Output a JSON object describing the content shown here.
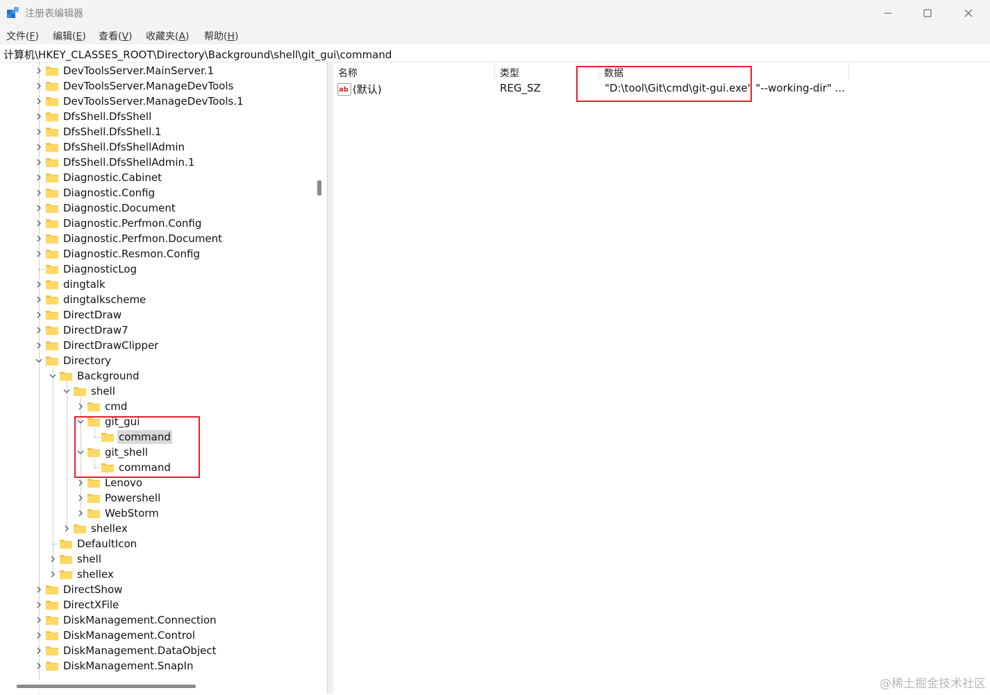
{
  "window": {
    "title": "注册表编辑器",
    "icons": [
      "registry-editor-icon",
      "minimize-icon",
      "maximize-icon",
      "close-icon"
    ]
  },
  "menu": [
    {
      "label": "文件(",
      "key": "F",
      "end": ")"
    },
    {
      "label": "编辑(",
      "key": "E",
      "end": ")"
    },
    {
      "label": "查看(",
      "key": "V",
      "end": ")"
    },
    {
      "label": "收藏夹(",
      "key": "A",
      "end": ")"
    },
    {
      "label": "帮助(",
      "key": "H",
      "end": ")"
    }
  ],
  "address": "计算机\\HKEY_CLASSES_ROOT\\Directory\\Background\\shell\\git_gui\\command",
  "tree": [
    {
      "label": "DevToolsServer.MainServer.1",
      "level": 0,
      "expander": ">"
    },
    {
      "label": "DevToolsServer.ManageDevTools",
      "level": 0,
      "expander": ">"
    },
    {
      "label": "DevToolsServer.ManageDevTools.1",
      "level": 0,
      "expander": ">"
    },
    {
      "label": "DfsShell.DfsShell",
      "level": 0,
      "expander": ">"
    },
    {
      "label": "DfsShell.DfsShell.1",
      "level": 0,
      "expander": ">"
    },
    {
      "label": "DfsShell.DfsShellAdmin",
      "level": 0,
      "expander": ">"
    },
    {
      "label": "DfsShell.DfsShellAdmin.1",
      "level": 0,
      "expander": ">"
    },
    {
      "label": "Diagnostic.Cabinet",
      "level": 0,
      "expander": ">"
    },
    {
      "label": "Diagnostic.Config",
      "level": 0,
      "expander": ">"
    },
    {
      "label": "Diagnostic.Document",
      "level": 0,
      "expander": ">"
    },
    {
      "label": "Diagnostic.Perfmon.Config",
      "level": 0,
      "expander": ">"
    },
    {
      "label": "Diagnostic.Perfmon.Document",
      "level": 0,
      "expander": ">"
    },
    {
      "label": "Diagnostic.Resmon.Config",
      "level": 0,
      "expander": ">"
    },
    {
      "label": "DiagnosticLog",
      "level": 0,
      "expander": ""
    },
    {
      "label": "dingtalk",
      "level": 0,
      "expander": ">"
    },
    {
      "label": "dingtalkscheme",
      "level": 0,
      "expander": ">"
    },
    {
      "label": "DirectDraw",
      "level": 0,
      "expander": ">"
    },
    {
      "label": "DirectDraw7",
      "level": 0,
      "expander": ">"
    },
    {
      "label": "DirectDrawClipper",
      "level": 0,
      "expander": ">"
    },
    {
      "label": "Directory",
      "level": 0,
      "expander": "v"
    },
    {
      "label": "Background",
      "level": 1,
      "expander": "v"
    },
    {
      "label": "shell",
      "level": 2,
      "expander": "v"
    },
    {
      "label": "cmd",
      "level": 3,
      "expander": ">"
    },
    {
      "label": "git_gui",
      "level": 3,
      "expander": "v"
    },
    {
      "label": "command",
      "level": 4,
      "expander": "",
      "selected": true
    },
    {
      "label": "git_shell",
      "level": 3,
      "expander": "v"
    },
    {
      "label": "command",
      "level": 4,
      "expander": ""
    },
    {
      "label": "Lenovo",
      "level": 3,
      "expander": ">"
    },
    {
      "label": "Powershell",
      "level": 3,
      "expander": ">"
    },
    {
      "label": "WebStorm",
      "level": 3,
      "expander": ">"
    },
    {
      "label": "shellex",
      "level": 2,
      "expander": ">"
    },
    {
      "label": "DefaultIcon",
      "level": 1,
      "expander": ""
    },
    {
      "label": "shell",
      "level": 1,
      "expander": ">"
    },
    {
      "label": "shellex",
      "level": 1,
      "expander": ">"
    },
    {
      "label": "DirectShow",
      "level": 0,
      "expander": ">"
    },
    {
      "label": "DirectXFile",
      "level": 0,
      "expander": ">"
    },
    {
      "label": "DiskManagement.Connection",
      "level": 0,
      "expander": ">"
    },
    {
      "label": "DiskManagement.Control",
      "level": 0,
      "expander": ">"
    },
    {
      "label": "DiskManagement.DataObject",
      "level": 0,
      "expander": ">"
    },
    {
      "label": "DiskManagement.SnapIn",
      "level": 0,
      "expander": ">"
    }
  ],
  "list": {
    "columns": [
      "名称",
      "类型",
      "数据"
    ],
    "rows": [
      {
        "name": "(默认)",
        "type": "REG_SZ",
        "data": "\"D:\\tool\\Git\\cmd\\git-gui.exe\" \"--working-dir\" ...",
        "icon": "string-value-icon"
      }
    ]
  },
  "watermark": "@稀土掘金技术社区",
  "colors": {
    "annotation": "#e0202a",
    "folder": "#f6c445",
    "selection": "#d9d9d9"
  }
}
